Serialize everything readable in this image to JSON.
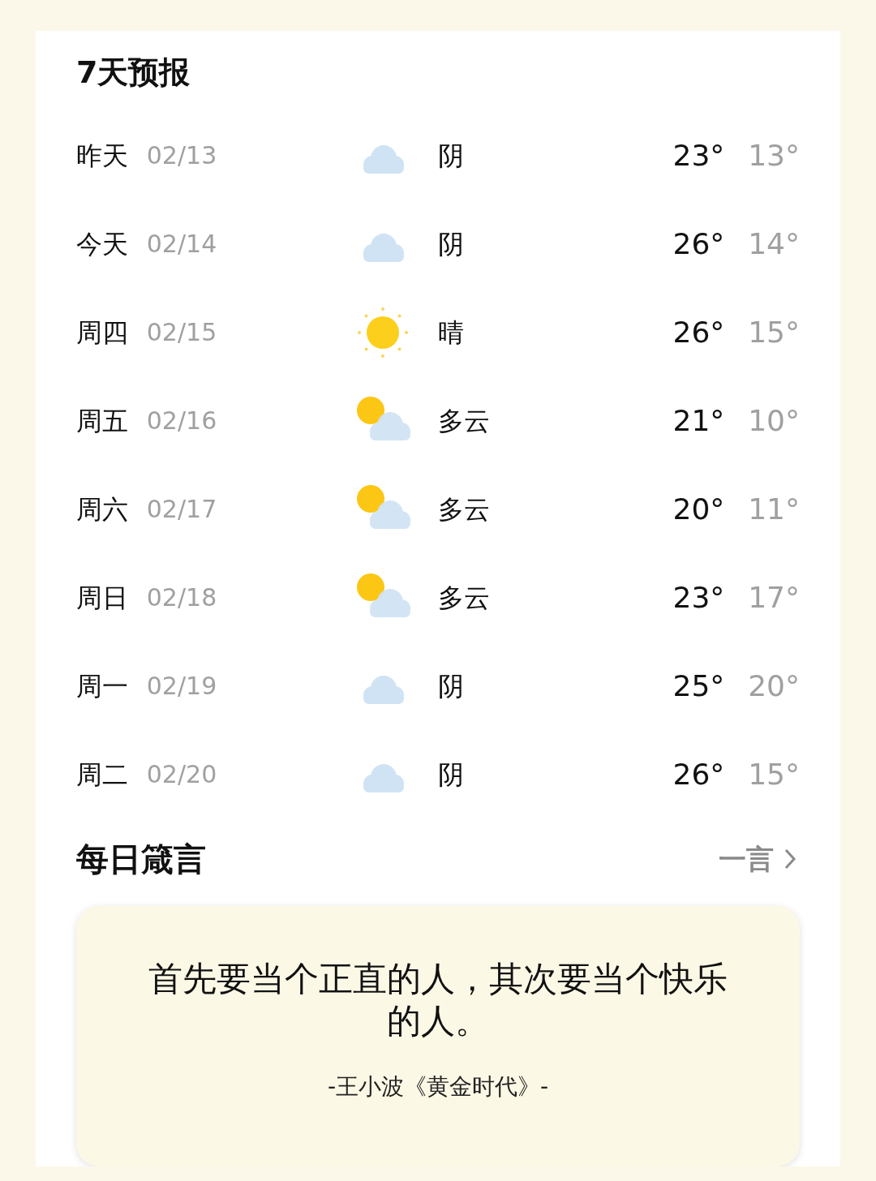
{
  "forecast": {
    "title": "7天预报",
    "days": [
      {
        "day": "昨天",
        "date": "02/13",
        "kind": "cloud",
        "condition": "阴",
        "high": "23°",
        "low": "13°"
      },
      {
        "day": "今天",
        "date": "02/14",
        "kind": "cloud",
        "condition": "阴",
        "high": "26°",
        "low": "14°"
      },
      {
        "day": "周四",
        "date": "02/15",
        "kind": "sun",
        "condition": "晴",
        "high": "26°",
        "low": "15°"
      },
      {
        "day": "周五",
        "date": "02/16",
        "kind": "partly",
        "condition": "多云",
        "high": "21°",
        "low": "10°"
      },
      {
        "day": "周六",
        "date": "02/17",
        "kind": "partly",
        "condition": "多云",
        "high": "20°",
        "low": "11°"
      },
      {
        "day": "周日",
        "date": "02/18",
        "kind": "partly",
        "condition": "多云",
        "high": "23°",
        "low": "17°"
      },
      {
        "day": "周一",
        "date": "02/19",
        "kind": "cloud",
        "condition": "阴",
        "high": "25°",
        "low": "20°"
      },
      {
        "day": "周二",
        "date": "02/20",
        "kind": "cloud",
        "condition": "阴",
        "high": "26°",
        "low": "15°"
      }
    ]
  },
  "motto": {
    "title": "每日箴言",
    "link": "一言",
    "quote": "首先要当个正直的人，其次要当个快乐的人。",
    "source": "-王小波《黄金时代》-"
  }
}
